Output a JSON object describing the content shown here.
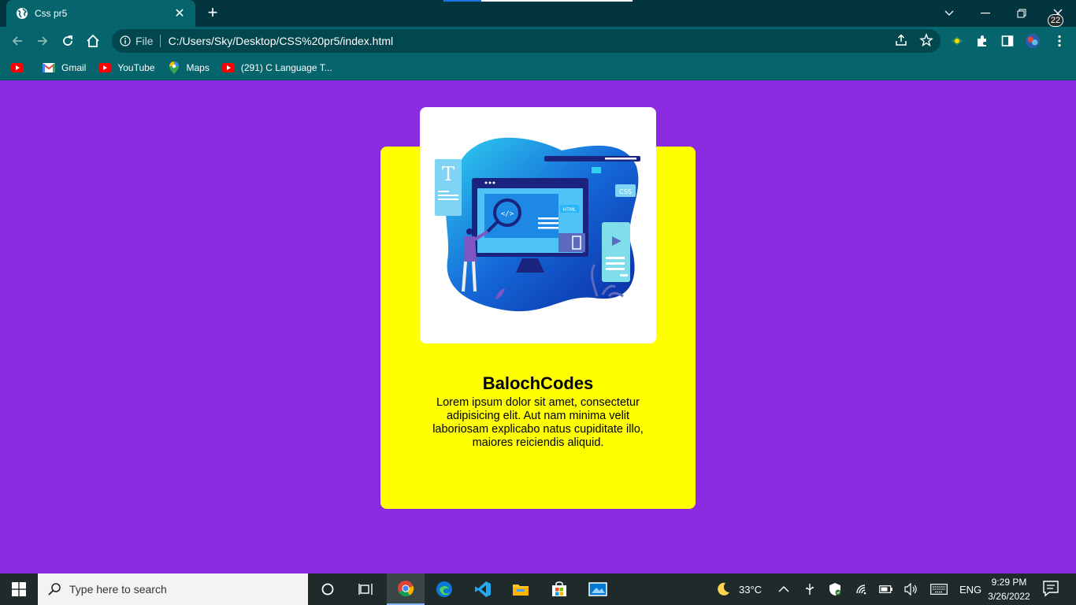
{
  "browser": {
    "tab_title": "Css pr5",
    "new_tab": "+",
    "url_scheme": "File",
    "url": "C:/Users/Sky/Desktop/CSS%20pr5/index.html",
    "bookmarks": [
      {
        "label": ""
      },
      {
        "label": "Gmail"
      },
      {
        "label": "YouTube"
      },
      {
        "label": "Maps"
      },
      {
        "label": "(291) C Language T..."
      }
    ]
  },
  "page": {
    "card_title": "BalochCodes",
    "card_text": "Lorem ipsum dolor sit amet, consectetur adipisicing elit. Aut nam minima velit laboriosam explicabo natus cupiditate illo, maiores reiciendis aliquid.",
    "illustration_labels": {
      "html": "HTML",
      "css": "CSS",
      "code": "</>",
      "t": "T"
    },
    "colors": {
      "background": "#8a2be2",
      "card": "#ffff00",
      "image_box": "#ffffff"
    }
  },
  "taskbar": {
    "search_placeholder": "Type here to search",
    "temperature": "33°C",
    "language": "ENG",
    "time": "9:29 PM",
    "date": "3/26/2022",
    "notification_count": "22"
  }
}
